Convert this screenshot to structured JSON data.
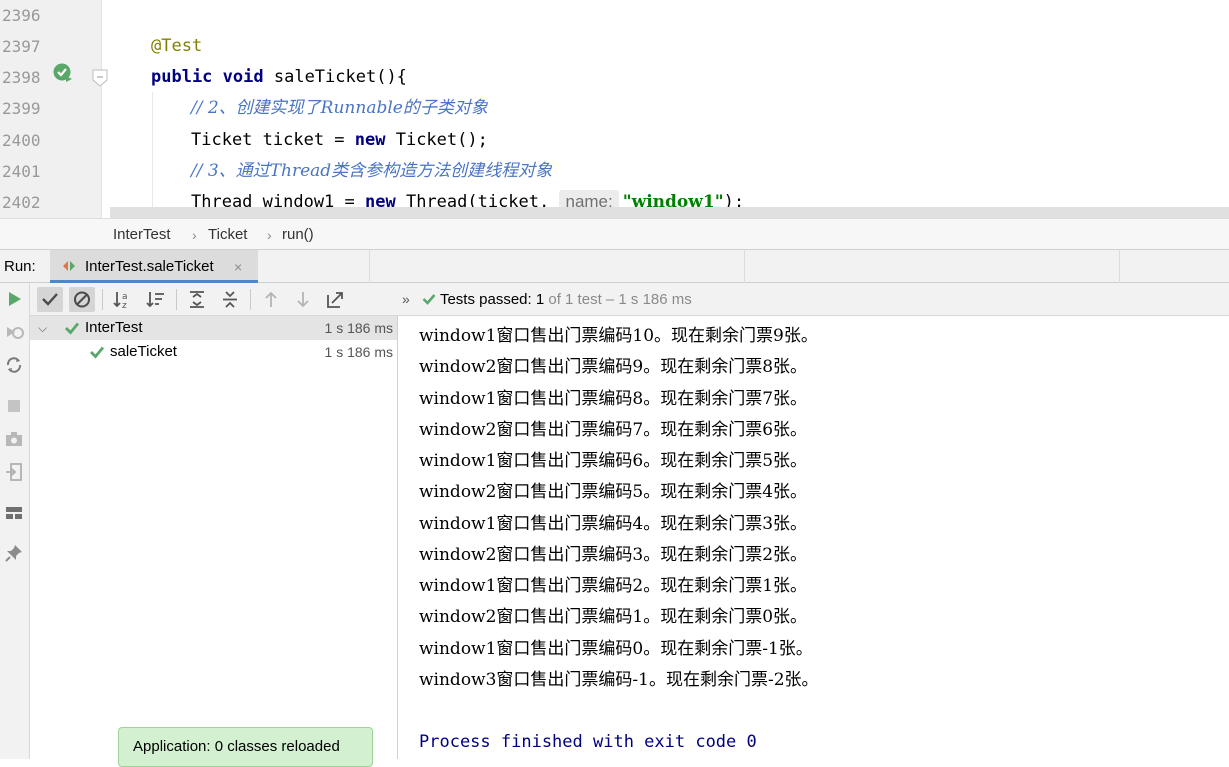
{
  "editor": {
    "lines": [
      {
        "num": "2396"
      },
      {
        "num": "2397",
        "annotation": "@Test"
      },
      {
        "num": "2398",
        "kw1": "public",
        "kw2": "void",
        "rest": " saleTicket(){"
      },
      {
        "num": "2399",
        "comment": "// 2、创建实现了Runnable的子类对象"
      },
      {
        "num": "2400",
        "pre": "Ticket ticket = ",
        "kw": "new",
        "post": " Ticket();"
      },
      {
        "num": "2401",
        "comment": "// 3、通过Thread类含参构造方法创建线程对象"
      },
      {
        "num": "2402",
        "pre": "Thread window1 = ",
        "kw": "new",
        "mid": " Thread(ticket, ",
        "hint": "name:",
        "str": "\"window1\"",
        "post": ");"
      }
    ]
  },
  "breadcrumb": [
    "InterTest",
    "Ticket",
    "run()"
  ],
  "run": {
    "label": "Run:",
    "tab_label": "InterTest.saleTicket",
    "close": "×"
  },
  "test_status": {
    "expand": "»",
    "passed": "Tests passed: ",
    "count": "1",
    "rest": " of 1 test – 1 s 186 ms"
  },
  "tree": [
    {
      "label": "InterTest",
      "time": "1 s 186 ms"
    },
    {
      "label": "saleTicket",
      "time": "1 s 186 ms"
    }
  ],
  "console": {
    "lines": [
      "window1窗口售出门票编码10。现在剩余门票9张。",
      "window2窗口售出门票编码9。现在剩余门票8张。",
      "window1窗口售出门票编码8。现在剩余门票7张。",
      "window2窗口售出门票编码7。现在剩余门票6张。",
      "window1窗口售出门票编码6。现在剩余门票5张。",
      "window2窗口售出门票编码5。现在剩余门票4张。",
      "window1窗口售出门票编码4。现在剩余门票3张。",
      "window2窗口售出门票编码3。现在剩余门票2张。",
      "window1窗口售出门票编码2。现在剩余门票1张。",
      "window2窗口售出门票编码1。现在剩余门票0张。",
      "window1窗口售出门票编码0。现在剩余门票-1张。",
      "window3窗口售出门票编码-1。现在剩余门票-2张。"
    ],
    "exit": "Process finished with exit code 0"
  },
  "notification": "Application: 0 classes reloaded",
  "icons": {
    "run": "run-icon",
    "rerun_failed": "rerun-failed-icon",
    "toggle_auto_test": "auto-test-icon",
    "stop": "stop-icon",
    "screenshot": "camera-icon",
    "import": "import-icon",
    "layout": "layout-icon",
    "pin": "pin-icon",
    "show_passed": "check-icon",
    "show_ignored": "ignored-icon",
    "sort_alpha": "sort-alpha-icon",
    "sort_duration": "sort-duration-icon",
    "expand_all": "expand-all-icon",
    "collapse_all": "collapse-all-icon",
    "prev": "arrow-up-icon",
    "next": "arrow-down-icon",
    "export": "export-icon"
  },
  "colors": {
    "pass": "#59a869",
    "keyword": "#000080",
    "comment": "#4a74c4",
    "string": "#008000",
    "selection_tab": "#4a88c7"
  }
}
